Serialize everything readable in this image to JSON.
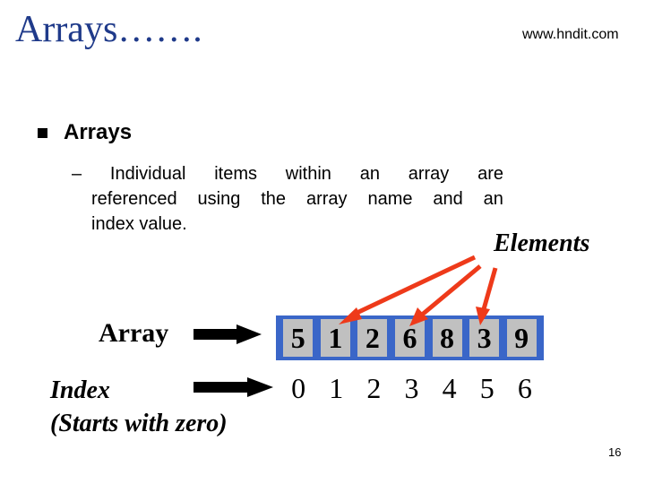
{
  "slide": {
    "title": "Arrays…….",
    "website": "www.hndit.com",
    "page_number": "16"
  },
  "bullet": {
    "heading": "Arrays",
    "sub_dash": "–",
    "sub_lines": [
      [
        "Individual",
        "items",
        "within",
        "an",
        "array",
        "are"
      ],
      [
        "referenced",
        "using",
        "the",
        "array",
        "name",
        "and",
        "an"
      ],
      [
        "index value."
      ]
    ]
  },
  "diagram": {
    "elements_label": "Elements",
    "array_label": "Array",
    "index_label_line1": "Index",
    "index_label_line2": "(Starts with zero)",
    "array_values": [
      "5",
      "1",
      "2",
      "6",
      "8",
      "3",
      "9"
    ],
    "indices": [
      "0",
      "1",
      "2",
      "3",
      "4",
      "5",
      "6"
    ],
    "highlighted_element_indices": [
      1,
      3,
      5
    ],
    "colors": {
      "array_border": "#3a66c8",
      "cell_fill": "#c0c0c0",
      "pointer_arrow": "#ee3a1a",
      "title": "#1f3a8a"
    }
  }
}
